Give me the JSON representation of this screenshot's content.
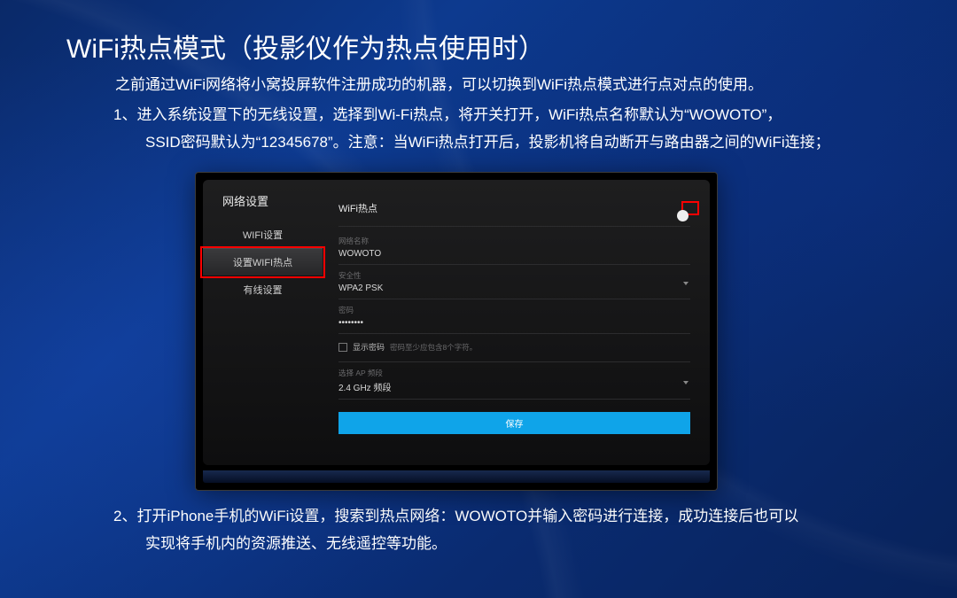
{
  "title": "WiFi热点模式（投影仪作为热点使用时）",
  "intro": "之前通过WiFi网络将小窝投屏软件注册成功的机器，可以切换到WiFi热点模式进行点对点的使用。",
  "step1_line1": "1、进入系统设置下的无线设置，选择到Wi-Fi热点，将开关打开，WiFi热点名称默认为“WOWOTO”，",
  "step1_line2": "SSID密码默认为“12345678”。注意：当WiFi热点打开后，投影机将自动断开与路由器之间的WiFi连接；",
  "step2_line1": "2、打开iPhone手机的WiFi设置，搜索到热点网络：WOWOTO并输入密码进行连接，成功连接后也可以",
  "step2_line2": "实现将手机内的资源推送、无线遥控等功能。",
  "panel": {
    "heading": "网络设置",
    "menu": {
      "wifi": "WIFI设置",
      "hotspot": "设置WIFI热点",
      "wired": "有线设置"
    },
    "hotspot_label": "WiFi热点",
    "fields": {
      "name_label": "网络名称",
      "name_value": "WOWOTO",
      "security_label": "安全性",
      "security_value": "WPA2 PSK",
      "password_label": "密码",
      "password_value": "••••••••",
      "show_pw_label": "显示密码",
      "show_pw_hint": "密码至少应包含8个字符。",
      "band_label": "选择 AP 频段",
      "band_value": "2.4 GHz 频段"
    },
    "save": "保存"
  }
}
